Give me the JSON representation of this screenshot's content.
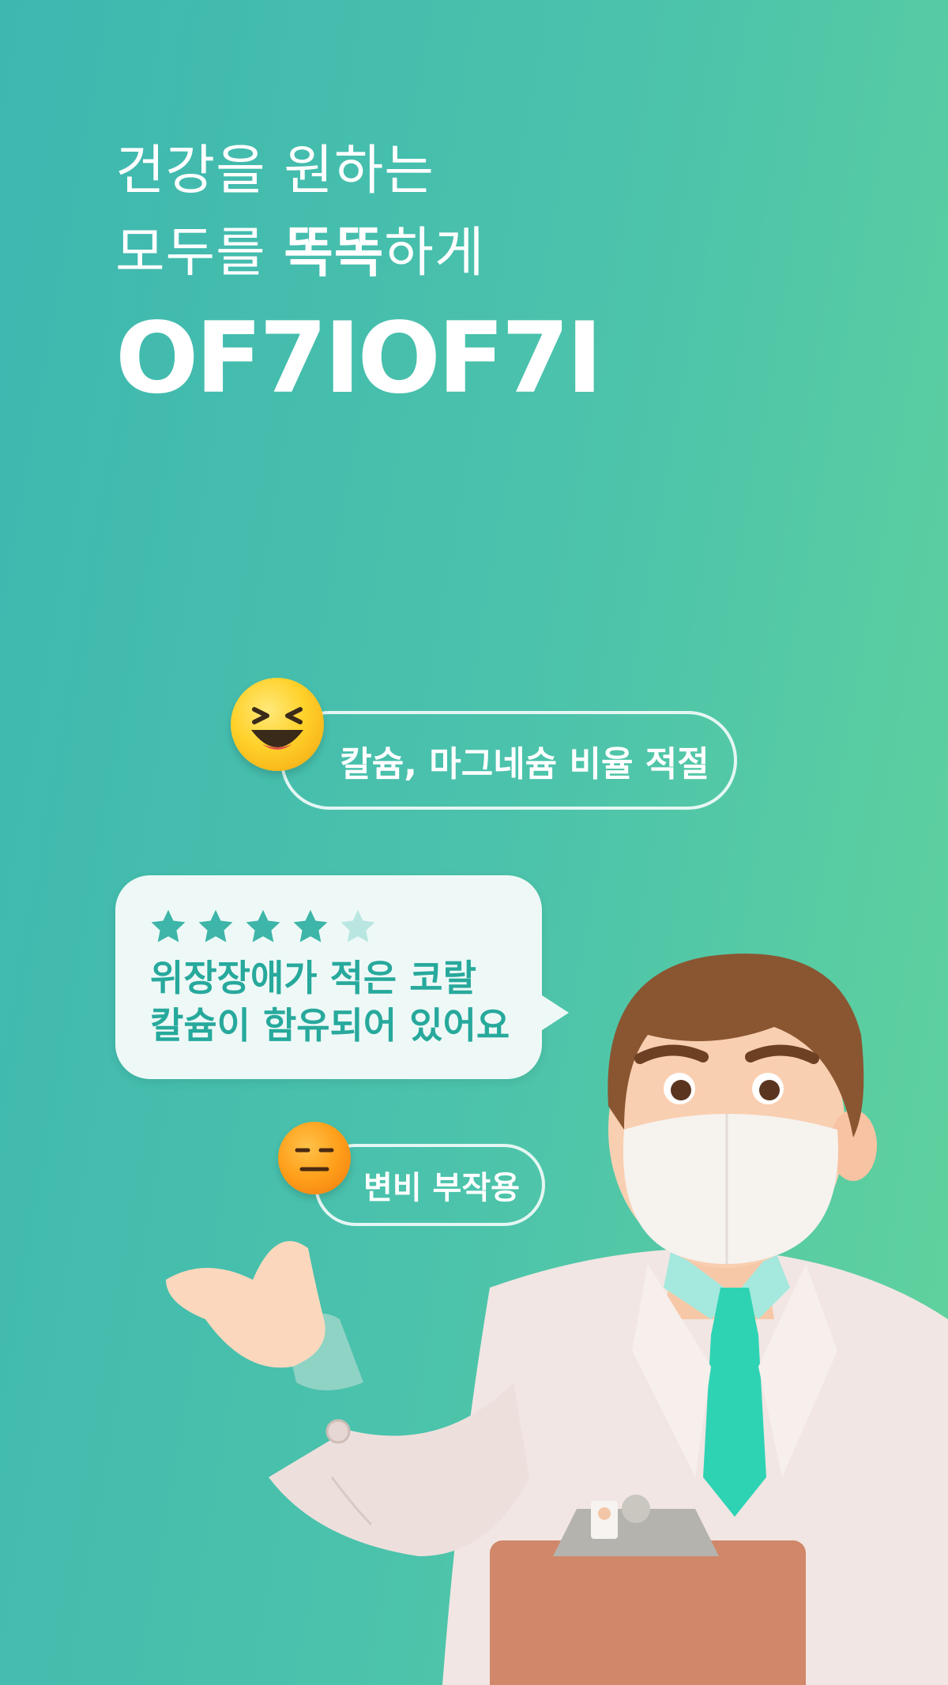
{
  "headline": {
    "line1": "건강을 원하는",
    "line2_prefix": "모두를 ",
    "line2_bold": "똑똑",
    "line2_suffix": "하게"
  },
  "logo": {
    "text": "OF7IOF7I"
  },
  "good_review": {
    "text": "칼슘, 마그네슘 비율 적절",
    "emoji": "laughing-face-icon"
  },
  "review_card": {
    "rating": 4,
    "max_rating": 5,
    "line1": "위장장애가 적은 코랄",
    "line2": "칼슘이 함유되어 있어요",
    "star_color": "#3db5a8",
    "star_empty_color": "#b9e6e1"
  },
  "bad_review": {
    "text": "변비 부작용",
    "emoji": "expressionless-face-icon"
  },
  "colors": {
    "gradient_start": "#3db7b0",
    "gradient_end": "#62d39c",
    "accent": "#27a99c"
  },
  "illustration": "doctor-with-clipboard"
}
